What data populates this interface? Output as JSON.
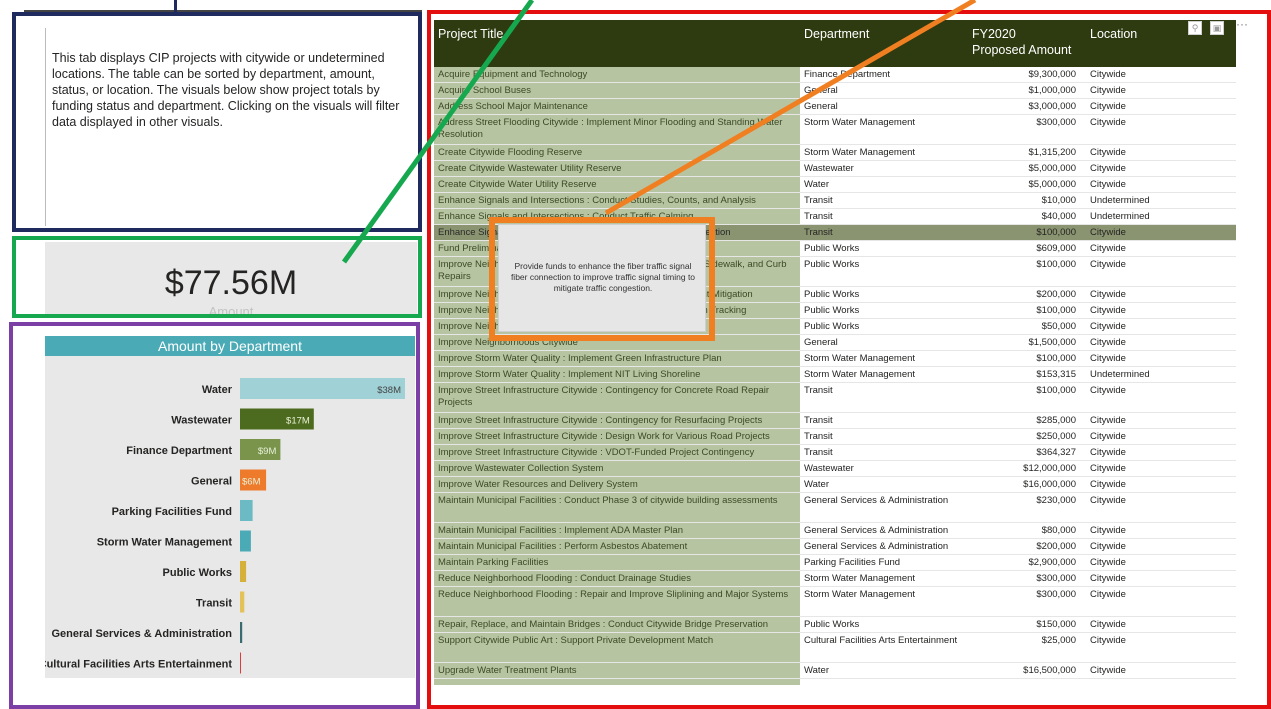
{
  "description": {
    "text": "This tab displays CIP projects with citywide or undetermined locations. The table can be sorted by department, amount, status, or location. The visuals below show project totals by funding status and department. Clicking on the visuals will filter data displayed in other visuals."
  },
  "kpi": {
    "value": "$77.56M",
    "label": "Amount"
  },
  "dept_chart": {
    "title": "Amount by Department",
    "chart_data": {
      "type": "bar",
      "title": "Amount by Department",
      "categories": [
        "Water",
        "Wastewater",
        "Finance Department",
        "General",
        "Parking Facilities Fund",
        "Storm Water Management",
        "Public Works",
        "Transit",
        "General Services & Administration",
        "Cultural Facilities Arts Entertainment"
      ],
      "values": [
        38.0,
        17.0,
        9.3,
        6.0,
        2.9,
        2.5,
        1.4,
        1.0,
        0.5,
        0.025
      ],
      "data_labels": [
        "$38M",
        "$17M",
        "$9M",
        "$6M",
        "",
        "",
        "",
        "",
        "",
        ""
      ],
      "colors": [
        "#9fd1d6",
        "#4d6b1e",
        "#7a944c",
        "#ee7a2b",
        "#6bbac4",
        "#4aaab6",
        "#d6b13a",
        "#e3c25a",
        "#3a6b6e",
        "#e03a3a"
      ]
    }
  },
  "table": {
    "headers": {
      "title": "Project Title",
      "department": "Department",
      "amount": "FY2020 Proposed Amount",
      "location": "Location"
    },
    "rows": [
      {
        "title": "Acquire Equipment and Technology",
        "department": "Finance Department",
        "amount": "$9,300,000",
        "location": "Citywide"
      },
      {
        "title": "Acquire School Buses",
        "department": "General",
        "amount": "$1,000,000",
        "location": "Citywide"
      },
      {
        "title": "Address School Major Maintenance",
        "department": "General",
        "amount": "$3,000,000",
        "location": "Citywide"
      },
      {
        "title": "Address Street Flooding Citywide : Implement Minor Flooding and Standing Water Resolution",
        "department": "Storm Water Management",
        "amount": "$300,000",
        "location": "Citywide"
      },
      {
        "title": "Create Citywide Flooding Reserve",
        "department": "Storm Water Management",
        "amount": "$1,315,200",
        "location": "Citywide"
      },
      {
        "title": "Create Citywide Wastewater Utility Reserve",
        "department": "Wastewater",
        "amount": "$5,000,000",
        "location": "Citywide"
      },
      {
        "title": "Create Citywide Water Utility Reserve",
        "department": "Water",
        "amount": "$5,000,000",
        "location": "Citywide"
      },
      {
        "title": "Enhance Signals and Intersections : Conduct Studies, Counts, and Analysis",
        "department": "Transit",
        "amount": "$10,000",
        "location": "Undetermined"
      },
      {
        "title": "Enhance Signals and Intersections : Conduct Traffic Calming",
        "department": "Transit",
        "amount": "$40,000",
        "location": "Undetermined"
      },
      {
        "title": "Enhance Signals and Intersections : Improve Signal Fiber Connection",
        "department": "Transit",
        "amount": "$100,000",
        "location": "Citywide"
      },
      {
        "title": "Fund Preliminary Engineering",
        "department": "Public Works",
        "amount": "$609,000",
        "location": "Citywide"
      },
      {
        "title": "Improve Neighborhood Streets : Perform Citywide Curb Ramp, Sidewalk, and Curb Repairs",
        "department": "Public Works",
        "amount": "$100,000",
        "location": "Citywide"
      },
      {
        "title": "Improve Neighborhood Streets : Implement Citywide Street Light Mitigation",
        "department": "Public Works",
        "amount": "$200,000",
        "location": "Citywide"
      },
      {
        "title": "Improve Neighborhood Streets : Implement Citywide Street Sign Tracking",
        "department": "Public Works",
        "amount": "$100,000",
        "location": "Citywide"
      },
      {
        "title": "Improve Neighborhood Streets : Improve Citywide Wayfinding",
        "department": "Public Works",
        "amount": "$50,000",
        "location": "Citywide"
      },
      {
        "title": "Improve Neighborhoods Citywide",
        "department": "General",
        "amount": "$1,500,000",
        "location": "Citywide"
      },
      {
        "title": "Improve Storm Water Quality : Implement Green Infrastructure Plan",
        "department": "Storm Water Management",
        "amount": "$100,000",
        "location": "Citywide"
      },
      {
        "title": "Improve Storm Water Quality : Implement NIT Living Shoreline",
        "department": "Storm Water Management",
        "amount": "$153,315",
        "location": "Undetermined"
      },
      {
        "title": "Improve Street Infrastructure Citywide : Contingency for Concrete Road Repair Projects",
        "department": "Transit",
        "amount": "$100,000",
        "location": "Citywide"
      },
      {
        "title": "Improve Street Infrastructure Citywide : Contingency for Resurfacing Projects",
        "department": "Transit",
        "amount": "$285,000",
        "location": "Citywide"
      },
      {
        "title": "Improve Street Infrastructure Citywide : Design Work for Various Road Projects",
        "department": "Transit",
        "amount": "$250,000",
        "location": "Citywide"
      },
      {
        "title": "Improve Street Infrastructure Citywide : VDOT-Funded Project Contingency",
        "department": "Transit",
        "amount": "$364,327",
        "location": "Citywide"
      },
      {
        "title": "Improve Wastewater Collection System",
        "department": "Wastewater",
        "amount": "$12,000,000",
        "location": "Citywide"
      },
      {
        "title": "Improve Water Resources and Delivery System",
        "department": "Water",
        "amount": "$16,000,000",
        "location": "Citywide"
      },
      {
        "title": "Maintain Municipal Facilities : Conduct Phase 3 of citywide building assessments",
        "department": "General Services & Administration",
        "amount": "$230,000",
        "location": "Citywide"
      },
      {
        "title": "Maintain Municipal Facilities : Implement ADA Master Plan",
        "department": "General Services & Administration",
        "amount": "$80,000",
        "location": "Citywide"
      },
      {
        "title": "Maintain Municipal Facilities : Perform Asbestos Abatement",
        "department": "General Services & Administration",
        "amount": "$200,000",
        "location": "Citywide"
      },
      {
        "title": "Maintain Parking Facilities",
        "department": "Parking Facilities Fund",
        "amount": "$2,900,000",
        "location": "Citywide"
      },
      {
        "title": "Reduce Neighborhood Flooding : Conduct Drainage Studies",
        "department": "Storm Water Management",
        "amount": "$300,000",
        "location": "Citywide"
      },
      {
        "title": "Reduce Neighborhood Flooding : Repair and Improve Sliplining and Major Systems",
        "department": "Storm Water Management",
        "amount": "$300,000",
        "location": "Citywide"
      },
      {
        "title": "Repair, Replace, and Maintain Bridges : Conduct Citywide Bridge Preservation",
        "department": "Public Works",
        "amount": "$150,000",
        "location": "Citywide"
      },
      {
        "title": "Support Citywide Public Art : Support Private Development Match",
        "department": "Cultural Facilities Arts Entertainment",
        "amount": "$25,000",
        "location": "Citywide"
      },
      {
        "title": "Upgrade Water Treatment Plants",
        "department": "Water",
        "amount": "$16,500,000",
        "location": "Citywide"
      }
    ]
  },
  "tooltip": {
    "text": "Provide funds to enhance the fiber traffic signal fiber connection to improve traffic signal timing to mitigate traffic congestion."
  },
  "icons": {
    "pin": "pin-icon",
    "focus": "focus-mode-icon",
    "more": "more-options-icon"
  },
  "colors": {
    "table_header": "#2e3a10",
    "title_column": "#b7c4a1",
    "frame_description": "#1f2b5e",
    "frame_kpi": "#16a84e",
    "frame_chart": "#7b3fa5",
    "frame_table": "#e40e0e",
    "frame_tooltip": "#f07f22"
  }
}
